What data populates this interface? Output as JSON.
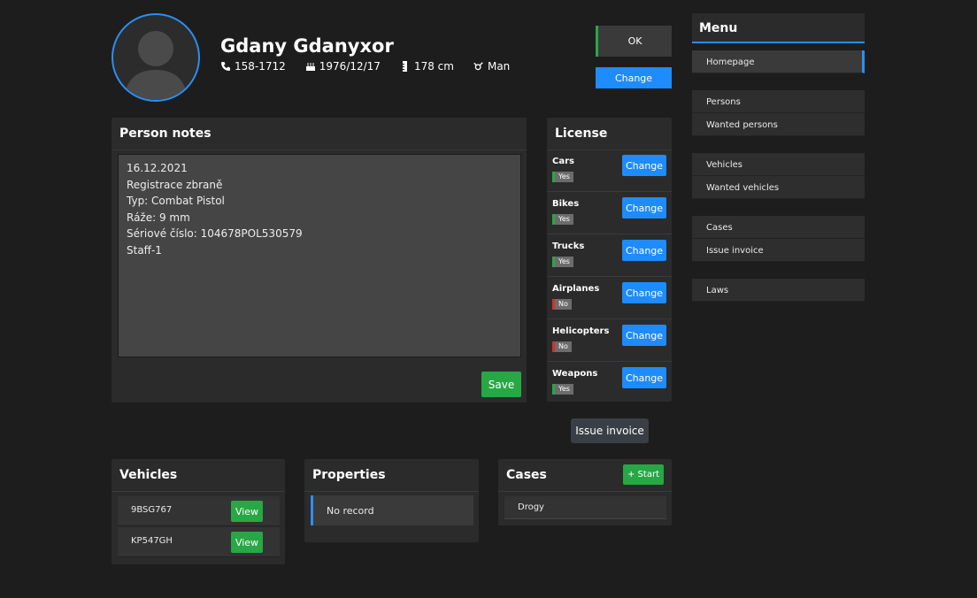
{
  "person": {
    "name": "Gdany Gdanyxor",
    "phone": "158-1712",
    "birthdate": "1976/12/17",
    "height": "178 cm",
    "gender": "Man"
  },
  "actions": {
    "ok_label": "OK",
    "change_label": "Change",
    "issue_invoice_label": "Issue invoice"
  },
  "notes": {
    "title": "Person notes",
    "text": "16.12.2021\nRegistrace zbraně\nTyp: Combat Pistol\nRáže: 9 mm\nSériové číslo: 104678POL530579\nStaff-1",
    "save_label": "Save"
  },
  "license": {
    "title": "License",
    "change_label": "Change",
    "items": [
      {
        "name": "Cars",
        "status": "Yes"
      },
      {
        "name": "Bikes",
        "status": "Yes"
      },
      {
        "name": "Trucks",
        "status": "Yes"
      },
      {
        "name": "Airplanes",
        "status": "No"
      },
      {
        "name": "Helicopters",
        "status": "No"
      },
      {
        "name": "Weapons",
        "status": "Yes"
      }
    ]
  },
  "vehicles": {
    "title": "Vehicles",
    "view_label": "View",
    "items": [
      {
        "plate": "9BSG767"
      },
      {
        "plate": "KP547GH"
      }
    ]
  },
  "properties": {
    "title": "Properties",
    "empty_label": "No record"
  },
  "cases": {
    "title": "Cases",
    "start_label": "+ Start",
    "items": [
      {
        "name": "Drogy"
      }
    ]
  },
  "menu": {
    "title": "Menu",
    "items": [
      {
        "label": "Homepage"
      },
      {
        "label": "Persons"
      },
      {
        "label": "Wanted persons"
      },
      {
        "label": "Vehicles"
      },
      {
        "label": "Wanted vehicles"
      },
      {
        "label": "Cases"
      },
      {
        "label": "Issue invoice"
      },
      {
        "label": "Laws"
      }
    ]
  },
  "colors": {
    "accent": "#2b8ff0",
    "primary_button": "#1e8bff",
    "success": "#27a745",
    "danger": "#d32f2f",
    "background": "#1d1d1d",
    "panel": "#2b2b2b"
  },
  "icons": [
    "avatar-placeholder-icon",
    "phone-icon",
    "birthday-cake-icon",
    "ruler-icon",
    "gender-icon"
  ]
}
